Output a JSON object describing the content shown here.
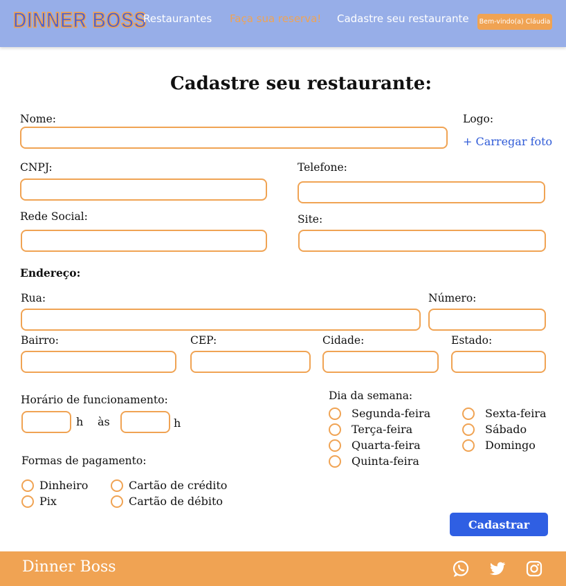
{
  "header": {
    "logo_text": "DINNER BOSS",
    "nav": {
      "restaurants": "Restaurantes",
      "reservation": "Faça sua reserva!",
      "register": "Cadastre seu restaurante"
    },
    "user_badge": "Bem-vindo(a) Cláudia"
  },
  "form": {
    "title": "Cadastre seu restaurante:",
    "name_label": "Nome:",
    "logo_label": "Logo:",
    "upload_link": "+ Carregar foto",
    "cnpj_label": "CNPJ:",
    "phone_label": "Telefone:",
    "social_label": "Rede Social:",
    "site_label": "Site:",
    "address_heading": "Endereço:",
    "street_label": "Rua:",
    "number_label": "Número:",
    "district_label": "Bairro:",
    "cep_label": "CEP:",
    "city_label": "Cidade:",
    "state_label": "Estado:",
    "hours_label": "Horário de funcionamento:",
    "hours_h1": "h",
    "hours_to": "às",
    "hours_h2": "h",
    "weekday_label": "Dia da semana:",
    "weekdays": [
      "Segunda-feira",
      "Terça-feira",
      "Quarta-feira",
      "Quinta-feira",
      "Sexta-feira",
      "Sábado",
      "Domingo"
    ],
    "payment_label": "Formas de pagamento:",
    "payments": [
      "Dinheiro",
      "Pix",
      "Cartão de crédito",
      "Cartão de débito"
    ],
    "submit_label": "Cadastrar"
  },
  "footer": {
    "brand": "Dinner Boss",
    "social_icons": [
      "whatsapp-icon",
      "twitter-icon",
      "instagram-icon"
    ]
  },
  "colors": {
    "header_bg": "#97aee8",
    "accent_orange": "#f0a353",
    "button_blue": "#2f5fe3",
    "link_blue": "#2f5bd7"
  }
}
